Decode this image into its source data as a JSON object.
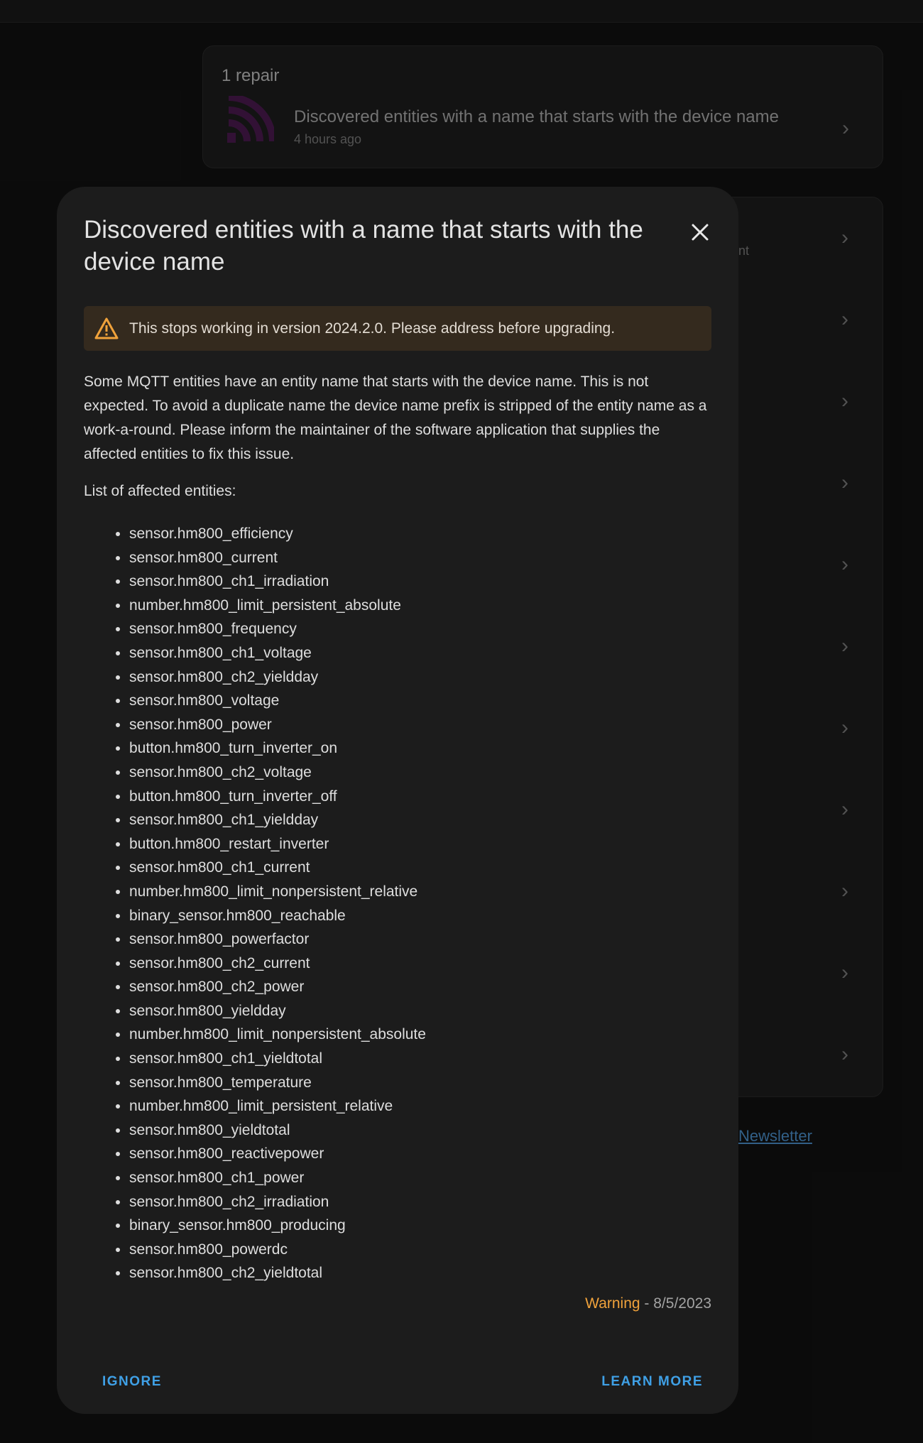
{
  "repairs": {
    "header": "1 repair",
    "item": {
      "title": "Discovered entities with a name that starts with the device name",
      "time": "4 hours ago"
    }
  },
  "background": {
    "settings_hint": "nt",
    "newsletter_link": "Newsletter"
  },
  "dialog": {
    "title": "Discovered entities with a name that starts with the device name",
    "alert_text": "This stops working in version 2024.2.0. Please address before upgrading.",
    "description": "Some MQTT entities have an entity name that starts with the device name. This is not expected. To avoid a duplicate name the device name prefix is stripped of the entity name as a work-a-round. Please inform the maintainer of the software application that supplies the affected entities to fix this issue.",
    "list_label": "List of affected entities:",
    "entities": [
      "sensor.hm800_efficiency",
      "sensor.hm800_current",
      "sensor.hm800_ch1_irradiation",
      "number.hm800_limit_persistent_absolute",
      "sensor.hm800_frequency",
      "sensor.hm800_ch1_voltage",
      "sensor.hm800_ch2_yieldday",
      "sensor.hm800_voltage",
      "sensor.hm800_power",
      "button.hm800_turn_inverter_on",
      "sensor.hm800_ch2_voltage",
      "button.hm800_turn_inverter_off",
      "sensor.hm800_ch1_yieldday",
      "button.hm800_restart_inverter",
      "sensor.hm800_ch1_current",
      "number.hm800_limit_nonpersistent_relative",
      "binary_sensor.hm800_reachable",
      "sensor.hm800_powerfactor",
      "sensor.hm800_ch2_current",
      "sensor.hm800_ch2_power",
      "sensor.hm800_yieldday",
      "number.hm800_limit_nonpersistent_absolute",
      "sensor.hm800_ch1_yieldtotal",
      "sensor.hm800_temperature",
      "number.hm800_limit_persistent_relative",
      "sensor.hm800_yieldtotal",
      "sensor.hm800_reactivepower",
      "sensor.hm800_ch1_power",
      "sensor.hm800_ch2_irradiation",
      "binary_sensor.hm800_producing",
      "sensor.hm800_powerdc",
      "sensor.hm800_ch2_yieldtotal"
    ],
    "severity": "Warning",
    "separator": " - ",
    "date": "8/5/2023",
    "ignore_label": "IGNORE",
    "learn_more_label": "LEARN MORE"
  },
  "icons": {
    "close": "close-icon",
    "alert": "warning-triangle-icon",
    "chevron": "chevron-right-icon",
    "mqtt_logo": "mqtt-logo-icon"
  },
  "colors": {
    "accent": "#3fa0e6",
    "warning": "#f0a23b",
    "alert_bg": "#342a1e",
    "mqtt_logo": "#4b1a4f"
  }
}
